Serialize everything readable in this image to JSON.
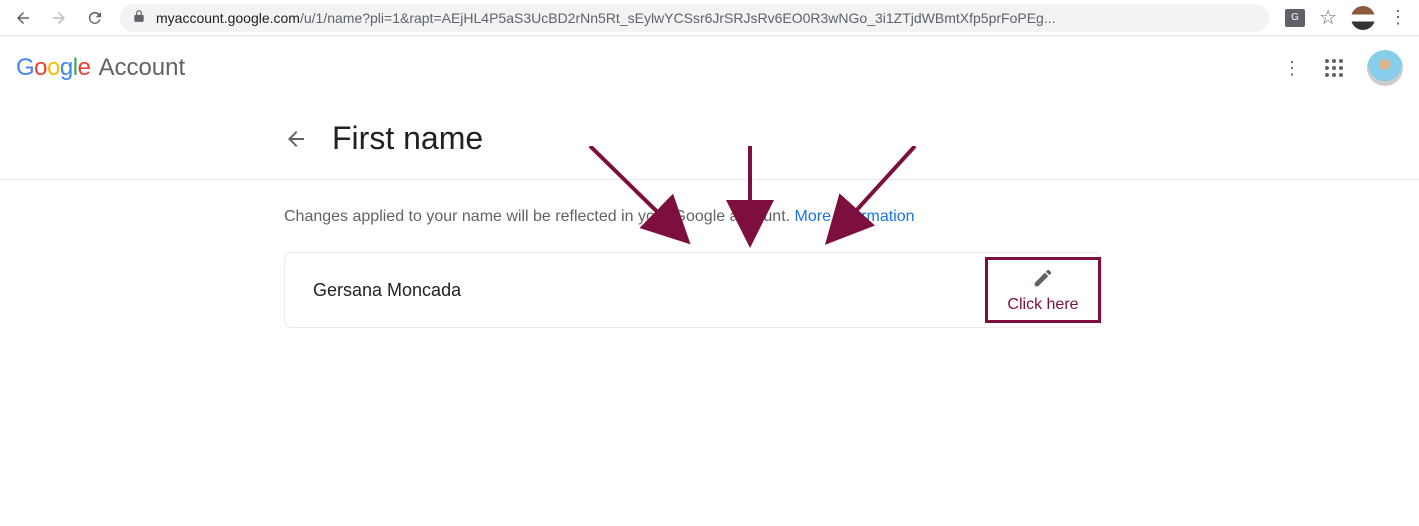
{
  "browser": {
    "url_host": "myaccount.google.com",
    "url_path": "/u/1/name?pli=1&rapt=AEjHL4P5aS3UcBD2rNn5Rt_sEylwYCSsr6JrSRJsRv6EO0R3wNGo_3i1ZTjdWBmtXfp5prFoPEg...",
    "translate_badge": "G"
  },
  "header": {
    "logo_letters": [
      "G",
      "o",
      "o",
      "g",
      "l",
      "e"
    ],
    "account_word": "Account"
  },
  "page": {
    "title": "First name",
    "description": "Changes applied to your name will be reflected in your Google account. ",
    "more_info_label": "More information",
    "name_value": "Gersana Moncada"
  },
  "annotation": {
    "click_label": "Click here"
  },
  "colors": {
    "annotation": "#7d0f3f",
    "link": "#1a73e8"
  }
}
